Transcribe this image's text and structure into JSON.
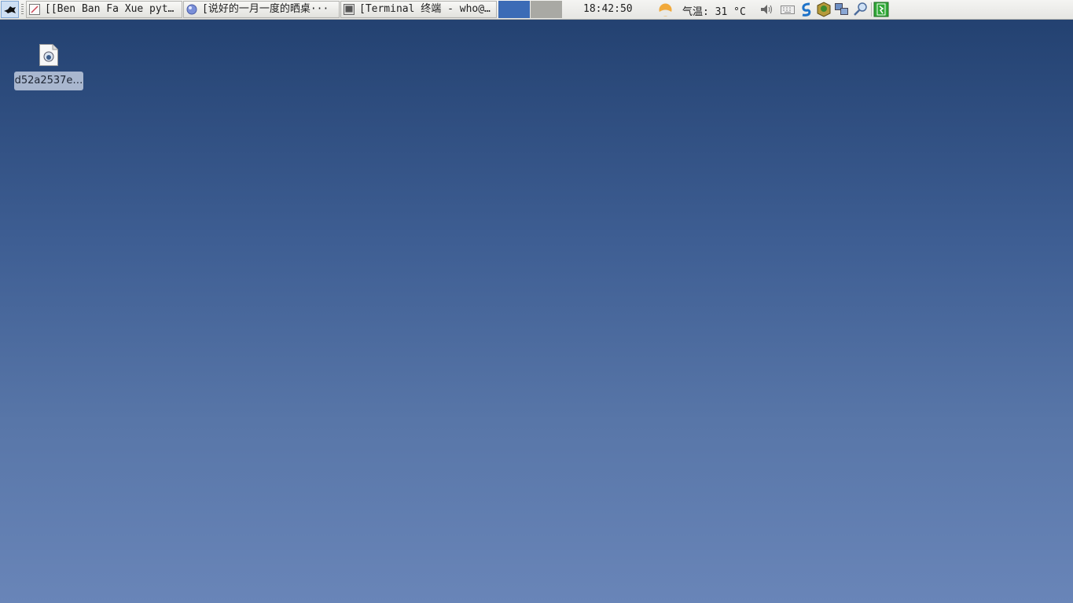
{
  "panel": {
    "tasks": [
      {
        "label": "[[Ben Ban Fa Xue pyt…",
        "icon": "editor-icon"
      },
      {
        "label": "[说好的一月一度的晒桌···",
        "icon": "browser-icon"
      },
      {
        "label": "[Terminal 终端 - who@…",
        "icon": "terminal-icon"
      }
    ],
    "clock": "18:42:50",
    "weather": {
      "text": "气温: 31 °C",
      "icon": "sun-icon"
    },
    "colors": {
      "active_workspace": "#3b6bb6",
      "inactive_workspace": "#a9a9a4",
      "desktop_top": "#213f6e",
      "desktop_bottom": "#6985b8"
    }
  },
  "desktop": {
    "icons": [
      {
        "label": "d52a2537e…"
      }
    ]
  }
}
